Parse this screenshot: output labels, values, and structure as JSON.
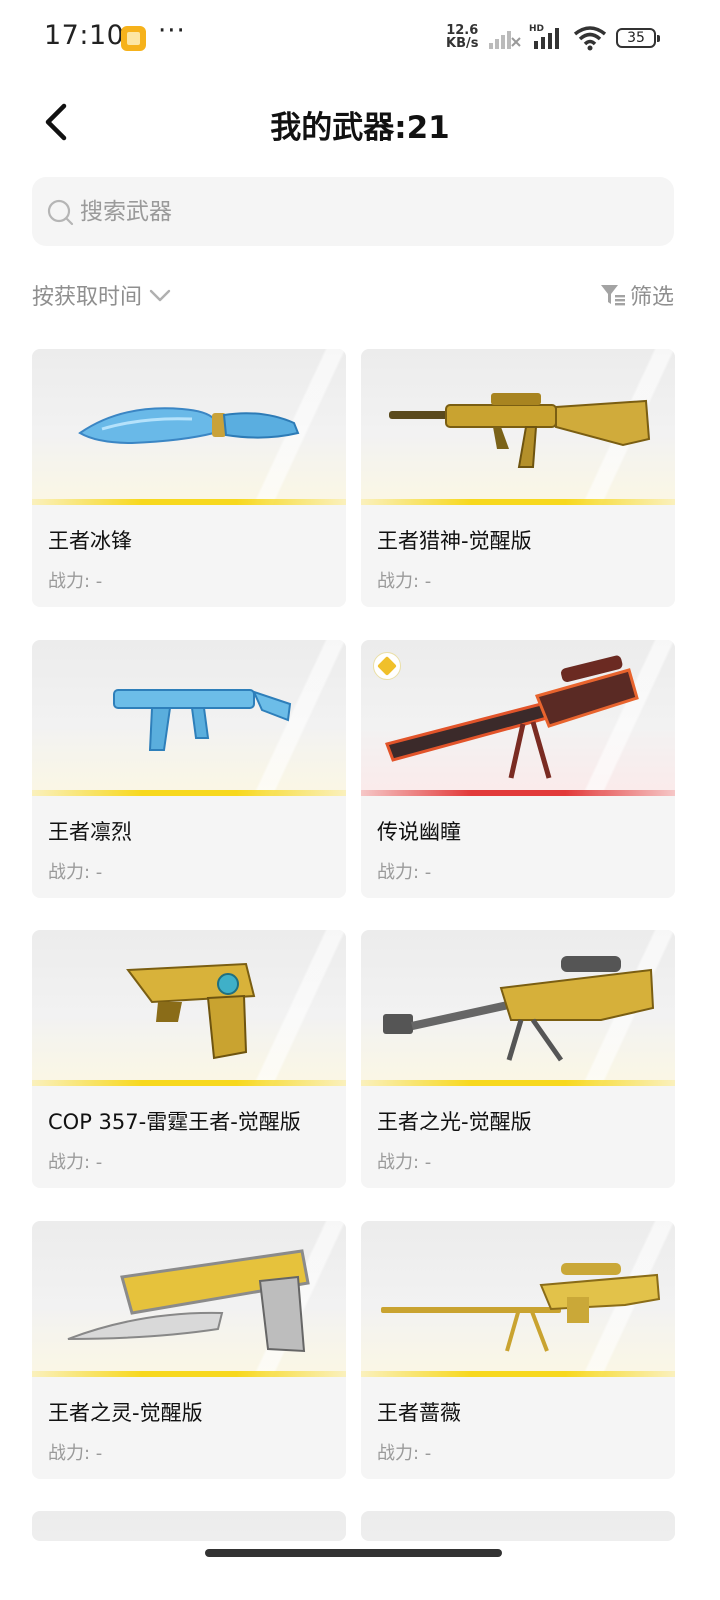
{
  "status_bar": {
    "time": "17:10",
    "more": "···",
    "speed_top": "12.6",
    "speed_bottom": "KB/s",
    "hd": "HD",
    "battery": "35"
  },
  "header": {
    "title": "我的武器:21",
    "back_icon": "chevron-left-icon"
  },
  "search": {
    "placeholder": "搜索武器",
    "value": ""
  },
  "toolbar": {
    "sort_label": "按获取时间",
    "filter_label": "筛选"
  },
  "weapons": [
    {
      "name": "王者冰锋",
      "power": "战力: -",
      "rarity": "gold"
    },
    {
      "name": "王者猎神-觉醒版",
      "power": "战力: -",
      "rarity": "gold"
    },
    {
      "name": "王者凛烈",
      "power": "战力: -",
      "rarity": "gold"
    },
    {
      "name": "传说幽瞳",
      "power": "战力: -",
      "rarity": "legend"
    },
    {
      "name": "COP 357-雷霆王者-觉醒版",
      "power": "战力: -",
      "rarity": "gold"
    },
    {
      "name": "王者之光-觉醒版",
      "power": "战力: -",
      "rarity": "gold"
    },
    {
      "name": "王者之灵-觉醒版",
      "power": "战力: -",
      "rarity": "gold"
    },
    {
      "name": "王者蔷薇",
      "power": "战力: -",
      "rarity": "gold"
    }
  ],
  "colors": {
    "gold_stripe": "#f7d81e",
    "legend_stripe": "#e23a3a",
    "card_bg": "#f5f5f5",
    "muted_text": "#9a9a9a"
  }
}
